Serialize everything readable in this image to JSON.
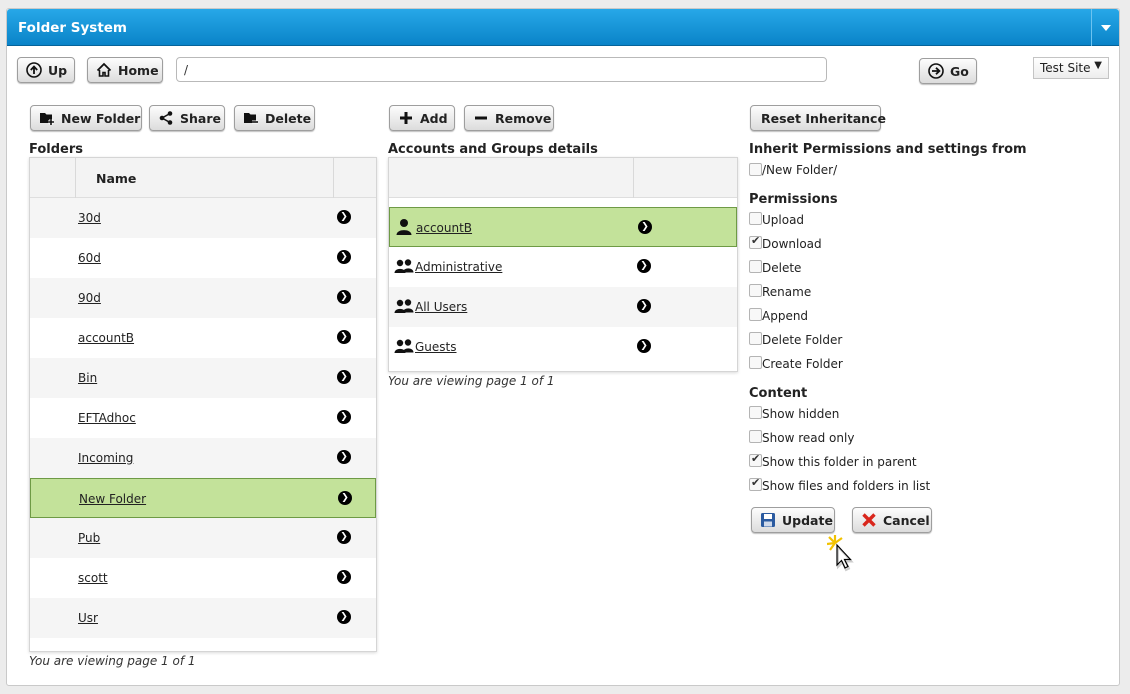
{
  "window": {
    "title": "Folder System"
  },
  "toolbar": {
    "up_label": "Up",
    "home_label": "Home",
    "path_value": "/",
    "go_label": "Go",
    "site_selected": "Test Site"
  },
  "folders": {
    "new_folder_label": "New Folder",
    "share_label": "Share",
    "delete_label": "Delete",
    "section_title": "Folders",
    "column_name": "Name",
    "rows": [
      {
        "name": "30d"
      },
      {
        "name": "60d"
      },
      {
        "name": "90d"
      },
      {
        "name": "accountB"
      },
      {
        "name": "Bin"
      },
      {
        "name": "EFTAdhoc"
      },
      {
        "name": "Incoming"
      },
      {
        "name": "New Folder",
        "selected": true
      },
      {
        "name": "Pub"
      },
      {
        "name": "scott"
      },
      {
        "name": "Usr"
      }
    ],
    "pager": "You are viewing page 1 of 1"
  },
  "accounts": {
    "add_label": "Add",
    "remove_label": "Remove",
    "section_title": "Accounts and Groups details",
    "rows": [
      {
        "name": "accountB",
        "icon": "user-icon",
        "selected": true
      },
      {
        "name": "Administrative",
        "icon": "group-icon"
      },
      {
        "name": "All Users",
        "icon": "group-icon"
      },
      {
        "name": "Guests",
        "icon": "group-icon"
      }
    ],
    "pager": "You are viewing page 1 of 1"
  },
  "permissions_panel": {
    "reset_label": "Reset Inheritance",
    "inherit_title": "Inherit Permissions and settings from",
    "inherit_path": "/New Folder/",
    "inherit_checked": false,
    "permissions_title": "Permissions",
    "permissions": [
      {
        "label": "Upload",
        "checked": false
      },
      {
        "label": "Download",
        "checked": true
      },
      {
        "label": "Delete",
        "checked": false
      },
      {
        "label": "Rename",
        "checked": false
      },
      {
        "label": "Append",
        "checked": false
      },
      {
        "label": "Delete Folder",
        "checked": false
      },
      {
        "label": "Create Folder",
        "checked": false
      }
    ],
    "content_title": "Content",
    "content": [
      {
        "label": "Show hidden",
        "checked": false
      },
      {
        "label": "Show read only",
        "checked": false
      },
      {
        "label": "Show this folder in parent",
        "checked": true
      },
      {
        "label": "Show files and folders in list",
        "checked": true
      }
    ],
    "update_label": "Update",
    "cancel_label": "Cancel"
  },
  "colors": {
    "titlebar": "#0a83c8",
    "selected_row": "#c3e29a",
    "selected_border": "#6e9a45",
    "cancel_x": "#d9261c",
    "update_icon": "#2a5aa0"
  }
}
